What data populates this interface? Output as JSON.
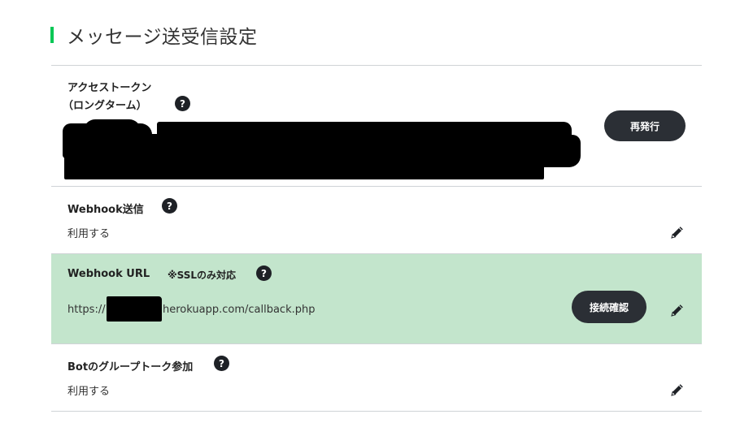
{
  "page": {
    "title": "メッセージ送受信設定",
    "accent_color": "#06c755"
  },
  "access_token": {
    "label_line1": "アクセストークン",
    "label_line2": "（ロングターム）",
    "help_icon": "question-circle-icon",
    "value": "",
    "reissue_label": "再発行"
  },
  "webhook_send": {
    "label": "Webhook送信",
    "help_icon": "question-circle-icon",
    "value": "利用する",
    "edit_icon": "pencil-icon"
  },
  "webhook_url": {
    "label": "Webhook URL",
    "note": "※SSLのみ対応",
    "help_icon": "question-circle-icon",
    "url_prefix": "https://",
    "url_suffix": "herokuapp.com/callback.php",
    "verify_label": "接続確認",
    "edit_icon": "pencil-icon",
    "highlight_color": "#c3e5cc"
  },
  "bot_group": {
    "label": "Botのグループトーク参加",
    "help_icon": "question-circle-icon",
    "value": "利用する",
    "edit_icon": "pencil-icon"
  }
}
